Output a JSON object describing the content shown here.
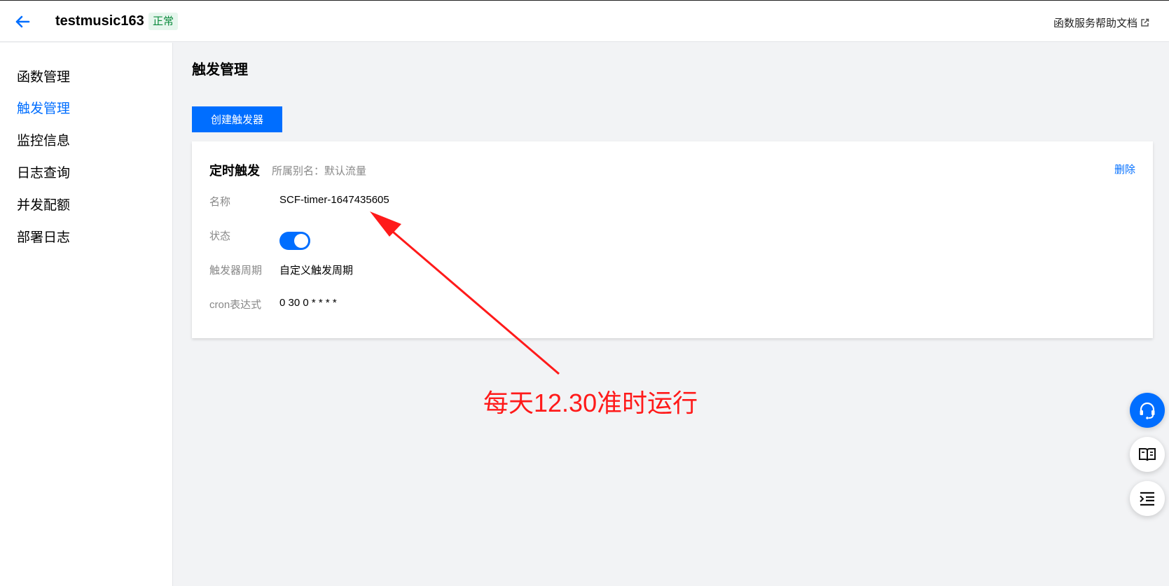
{
  "header": {
    "app_title": "testmusic163",
    "status_badge": "正常",
    "help_link": "函数服务帮助文档"
  },
  "sidebar": {
    "items": [
      {
        "label": "函数管理",
        "active": false
      },
      {
        "label": "触发管理",
        "active": true
      },
      {
        "label": "监控信息",
        "active": false
      },
      {
        "label": "日志查询",
        "active": false
      },
      {
        "label": "并发配额",
        "active": false
      },
      {
        "label": "部署日志",
        "active": false
      }
    ]
  },
  "main": {
    "page_title": "触发管理",
    "create_button": "创建触发器",
    "trigger": {
      "title": "定时触发",
      "alias": "所属别名：默认流量",
      "delete_label": "删除",
      "name_label": "名称",
      "name_value": "SCF-timer-1647435605",
      "status_label": "状态",
      "status_enabled": true,
      "period_label": "触发器周期",
      "period_value": "自定义触发周期",
      "cron_label": "cron表达式",
      "cron_value": "0 30 0 * * * *"
    }
  },
  "annotation": {
    "text": "每天12.30准时运行",
    "color": "#ff1a1a"
  },
  "floating_buttons": [
    "headset-icon",
    "book-icon",
    "list-indent-icon"
  ],
  "colors": {
    "accent": "#006eff",
    "status_green": "#0a8a3c"
  }
}
